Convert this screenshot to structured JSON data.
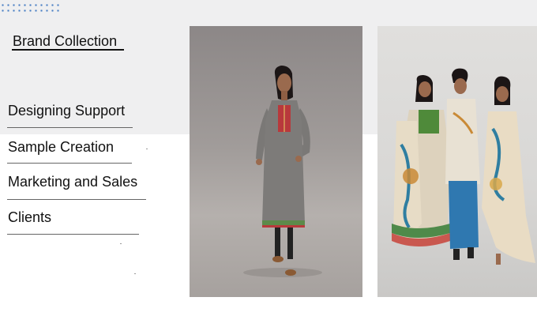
{
  "brand_collection": {
    "heading": "Brand Collection"
  },
  "menu": {
    "items": [
      {
        "label": "Designing Support"
      },
      {
        "label": "Sample Creation"
      },
      {
        "label": "Marketing and Sales"
      },
      {
        "label": "Clients"
      }
    ]
  },
  "colors": {
    "top_band": "#efeff0",
    "dot_accent": "#4a7fc4",
    "text": "#111111"
  }
}
